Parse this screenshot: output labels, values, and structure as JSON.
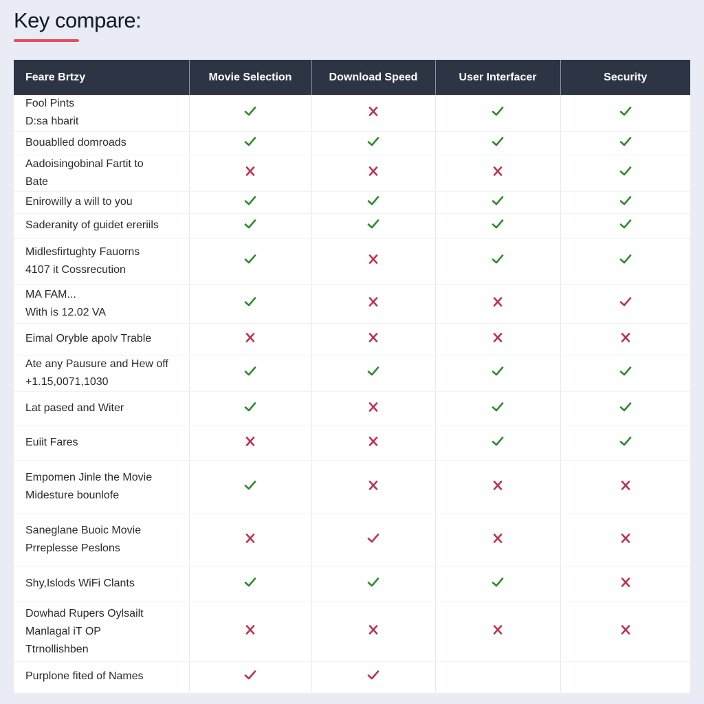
{
  "page": {
    "title": "Key compare:",
    "accent_color": "#e0505f",
    "header_bg": "#2d3545",
    "check_color": "#2e8b2e",
    "cross_color": "#c0334d"
  },
  "table": {
    "columns": [
      "Feare Brtzy",
      "Movie Selection",
      "Download Speed",
      "User Interfacer",
      "Security"
    ],
    "rows": [
      {
        "lines": [
          "Fool Pints",
          "D:sa hbarit"
        ],
        "marks": [
          "check",
          "cross",
          "check",
          "check"
        ]
      },
      {
        "lines": [
          "Bouablled domroads"
        ],
        "marks": [
          "check",
          "check",
          "check",
          "check"
        ]
      },
      {
        "lines": [
          "Aadoisingobinal Fartit to",
          "Bate"
        ],
        "marks": [
          "cross",
          "cross",
          "cross",
          "check"
        ]
      },
      {
        "lines": [
          "Enirowilly a will to you"
        ],
        "marks": [
          "check",
          "check",
          "check",
          "check"
        ]
      },
      {
        "lines": [
          "Saderanity of guidet ereriils"
        ],
        "marks": [
          "check",
          "check",
          "check",
          "check"
        ]
      },
      {
        "lines": [
          "Midlesfirtughty Fauorns",
          "4107 it Cossrecution"
        ],
        "marks": [
          "check",
          "cross",
          "check",
          "check"
        ]
      },
      {
        "lines": [
          "MA FAM...",
          "With is 12.02 VA"
        ],
        "marks": [
          "check",
          "cross",
          "cross",
          "check-red"
        ]
      },
      {
        "lines": [
          "Eimal Orуble apolv Trable"
        ],
        "marks": [
          "cross",
          "cross",
          "cross",
          "cross"
        ]
      },
      {
        "lines": [
          "Ate any Pausure and Hew off",
          "+1.15,0071,1030"
        ],
        "marks": [
          "check",
          "check",
          "check",
          "check"
        ]
      },
      {
        "lines": [
          "Lat pased and Witer"
        ],
        "marks": [
          "check",
          "cross",
          "check",
          "check"
        ]
      },
      {
        "lines": [
          "Euiit Fares"
        ],
        "marks": [
          "cross",
          "cross",
          "check",
          "check"
        ]
      },
      {
        "lines": [
          "Empomen Jinle the Movie",
          "Midesture bounlofe"
        ],
        "marks": [
          "check",
          "cross",
          "cross",
          "cross"
        ]
      },
      {
        "lines": [
          "Saneglane Buoic Movie",
          "Prreplesse Peslons"
        ],
        "marks": [
          "cross",
          "check-red",
          "cross",
          "cross"
        ]
      },
      {
        "lines": [
          "Shy,Islods WiFi Clants"
        ],
        "marks": [
          "check",
          "check",
          "check",
          "cross"
        ]
      },
      {
        "lines": [
          "Dowhad Rupers Oylsailt",
          "Manlagal iT OP",
          "Ttrnollishben"
        ],
        "marks": [
          "cross",
          "cross",
          "cross",
          "cross"
        ]
      },
      {
        "lines": [
          "Purplone fited of Names"
        ],
        "marks": [
          "check-red",
          "check-red",
          "none",
          "none"
        ]
      }
    ]
  }
}
